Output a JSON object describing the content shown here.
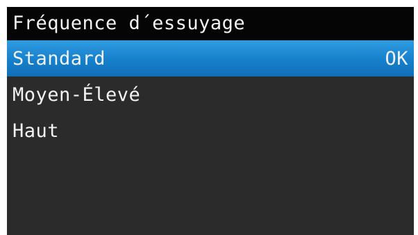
{
  "title": "Fréquence d´essuyage",
  "items": [
    {
      "label": "Standard",
      "status": "OK",
      "selected": true
    },
    {
      "label": "Moyen-Élevé",
      "status": "",
      "selected": false
    },
    {
      "label": "Haut",
      "status": "",
      "selected": false
    }
  ],
  "colors": {
    "background": "#2b2b2b",
    "title_bar": "#050505",
    "selection": "#1a86d1",
    "text": "#f2f2f2"
  }
}
